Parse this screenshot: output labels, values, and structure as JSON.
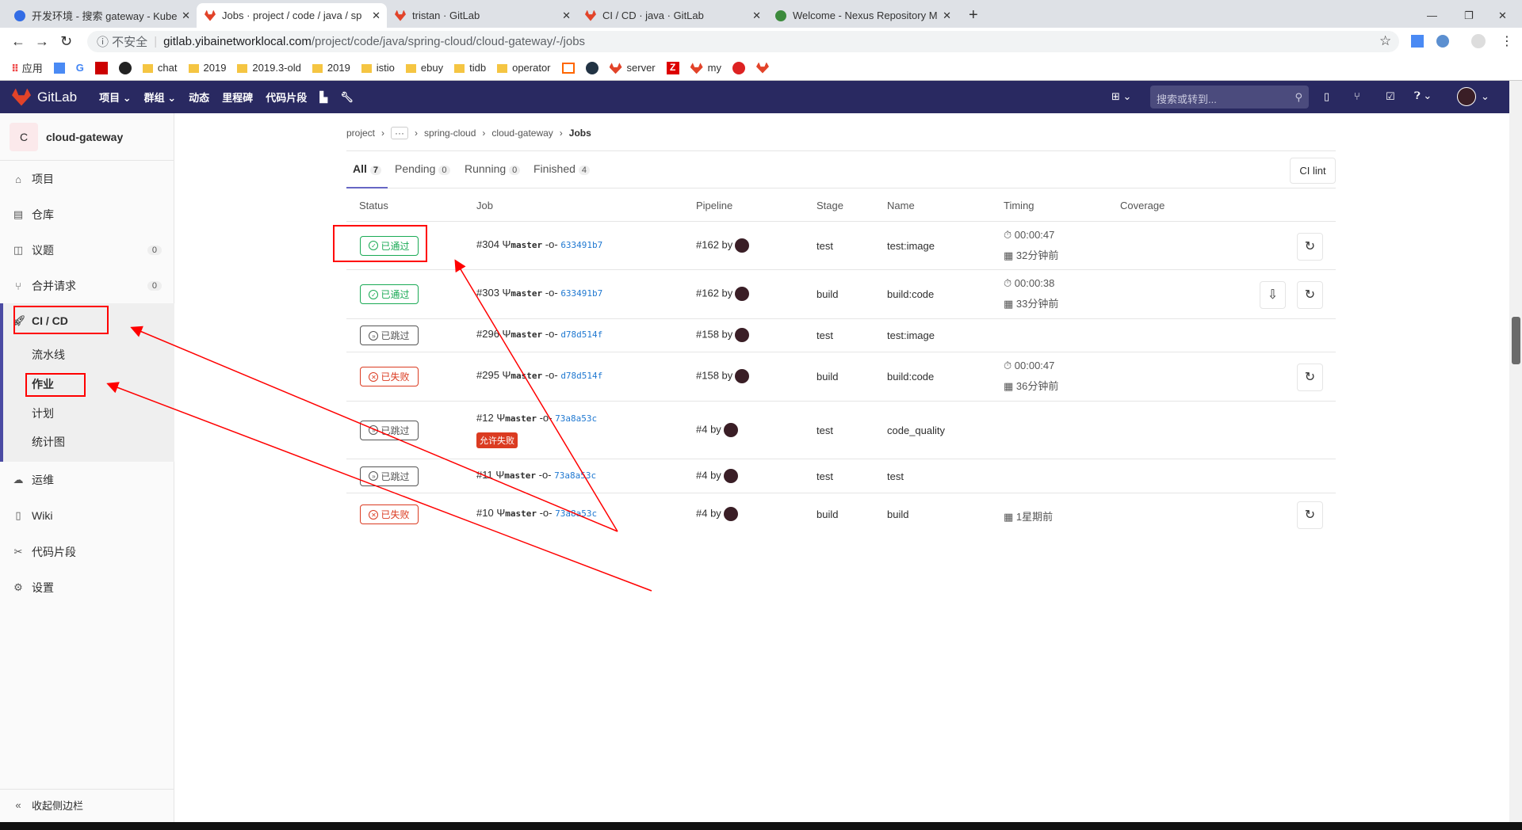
{
  "browser": {
    "tabs": [
      {
        "title": "开发环境 - 搜索 gateway - Kube"
      },
      {
        "title": "Jobs · project / code / java / sp"
      },
      {
        "title": "tristan · GitLab"
      },
      {
        "title": "CI / CD · java · GitLab"
      },
      {
        "title": "Welcome - Nexus Repository M"
      }
    ],
    "new_tab": "+",
    "security": "不安全",
    "url_host": "gitlab.yibainetworklocal.com",
    "url_path": "/project/code/java/spring-cloud/cloud-gateway/-/jobs",
    "bookmarks": [
      "应用",
      "chat",
      "2019",
      "2019.3-old",
      "2019",
      "istio",
      "ebuy",
      "tidb",
      "operator",
      "server",
      "my"
    ]
  },
  "navbar": {
    "brand": "GitLab",
    "items": [
      "项目",
      "群组",
      "动态",
      "里程碑",
      "代码片段"
    ],
    "search_placeholder": "搜索或转到..."
  },
  "sidebar": {
    "project_initial": "C",
    "project_name": "cloud-gateway",
    "items": [
      {
        "label": "项目",
        "icon": "home-icon"
      },
      {
        "label": "仓库",
        "icon": "doc-icon"
      },
      {
        "label": "议题",
        "icon": "issues-icon",
        "count": "0"
      },
      {
        "label": "合并请求",
        "icon": "merge-icon",
        "count": "0"
      },
      {
        "label": "CI / CD",
        "icon": "rocket-icon"
      },
      {
        "label": "运维",
        "icon": "cloud-icon"
      },
      {
        "label": "Wiki",
        "icon": "book-icon"
      },
      {
        "label": "代码片段",
        "icon": "scissors-icon"
      },
      {
        "label": "设置",
        "icon": "gear-icon"
      }
    ],
    "cicd_sub": [
      "流水线",
      "作业",
      "计划",
      "统计图"
    ],
    "collapse": "收起侧边栏"
  },
  "breadcrumb": [
    "project",
    "···",
    "spring-cloud",
    "cloud-gateway",
    "Jobs"
  ],
  "filters": [
    {
      "label": "All",
      "count": "7"
    },
    {
      "label": "Pending",
      "count": "0"
    },
    {
      "label": "Running",
      "count": "0"
    },
    {
      "label": "Finished",
      "count": "4"
    }
  ],
  "ci_lint": "CI lint",
  "columns": [
    "Status",
    "Job",
    "Pipeline",
    "Stage",
    "Name",
    "Timing",
    "Coverage"
  ],
  "jobs": [
    {
      "status": "已通过",
      "kind": "pass",
      "id": "#304",
      "branch": "master",
      "sha": "633491b7",
      "pipeline": "#162 by",
      "stage": "test",
      "name": "test:image",
      "duration": "00:00:47",
      "ago": "32分钟前"
    },
    {
      "status": "已通过",
      "kind": "pass",
      "id": "#303",
      "branch": "master",
      "sha": "633491b7",
      "pipeline": "#162 by",
      "stage": "build",
      "name": "build:code",
      "duration": "00:00:38",
      "ago": "33分钟前"
    },
    {
      "status": "已跳过",
      "kind": "skip",
      "id": "#296",
      "branch": "master",
      "sha": "d78d514f",
      "pipeline": "#158 by",
      "stage": "test",
      "name": "test:image"
    },
    {
      "status": "已失败",
      "kind": "fail",
      "id": "#295",
      "branch": "master",
      "sha": "d78d514f",
      "pipeline": "#158 by",
      "stage": "build",
      "name": "build:code",
      "duration": "00:00:47",
      "ago": "36分钟前"
    },
    {
      "status": "已跳过",
      "kind": "skip",
      "id": "#12",
      "branch": "master",
      "sha": "73a8a53c",
      "tag": "允许失败",
      "pipeline": "#4 by",
      "stage": "test",
      "name": "code_quality"
    },
    {
      "status": "已跳过",
      "kind": "skip",
      "id": "#11",
      "branch": "master",
      "sha": "73a8a53c",
      "pipeline": "#4 by",
      "stage": "test",
      "name": "test"
    },
    {
      "status": "已失败",
      "kind": "fail",
      "id": "#10",
      "branch": "master",
      "sha": "73a8a53c",
      "pipeline": "#4 by",
      "stage": "build",
      "name": "build",
      "ago": "1星期前"
    }
  ],
  "colors": {
    "navbar": "#292961",
    "passed": "#1aaa55",
    "failed": "#db3b21",
    "link": "#1f78d1",
    "annotation": "#ff0000"
  }
}
